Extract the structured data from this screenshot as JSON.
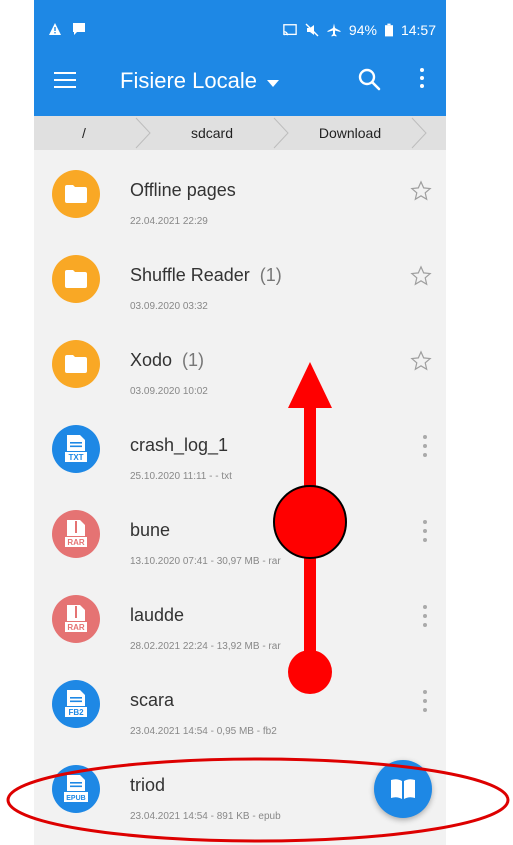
{
  "status_bar": {
    "battery": "94%",
    "time": "14:57",
    "icons_left": [
      "warning-icon",
      "message-icon"
    ],
    "icons_right": [
      "cast-icon",
      "mute-icon",
      "airplane-icon",
      "battery-icon"
    ]
  },
  "app_bar": {
    "title": "Fisiere Locale",
    "menu_icon": "hamburger-icon",
    "search_icon": "search-icon",
    "more_icon": "more-vert-icon",
    "color": "#1e88e5"
  },
  "breadcrumb": {
    "items": [
      "/",
      "sdcard",
      "Download"
    ]
  },
  "files": [
    {
      "name": "Offline pages",
      "count": "",
      "meta": "22.04.2021 22:29",
      "type": "folder",
      "action": "star"
    },
    {
      "name": "Shuffle Reader",
      "count": "(1)",
      "meta": "03.09.2020 03:32",
      "type": "folder",
      "action": "star"
    },
    {
      "name": "Xodo",
      "count": "(1)",
      "meta": "03.09.2020 10:02",
      "type": "folder",
      "action": "star"
    },
    {
      "name": "crash_log_1",
      "count": "",
      "meta": "25.10.2020 11:11 - - txt",
      "type": "TXT",
      "action": "menu"
    },
    {
      "name": "bune",
      "count": "",
      "meta": "13.10.2020 07:41 - 30,97 MB - rar",
      "type": "RAR",
      "action": "menu"
    },
    {
      "name": "laudde",
      "count": "",
      "meta": "28.02.2021 22:24 - 13,92 MB - rar",
      "type": "RAR",
      "action": "menu"
    },
    {
      "name": "scara",
      "count": "",
      "meta": "23.04.2021 14:54 - 0,95 MB - fb2",
      "type": "FB2",
      "action": "menu"
    },
    {
      "name": "triod",
      "count": "",
      "meta": "23.04.2021 14:54 - 891 KB - epub",
      "type": "EPUB",
      "action": "none"
    }
  ],
  "fab": {
    "icon": "book-open-icon"
  },
  "annotation": {
    "arrow_color": "#ff0000",
    "ellipse_color": "#dd0000"
  }
}
